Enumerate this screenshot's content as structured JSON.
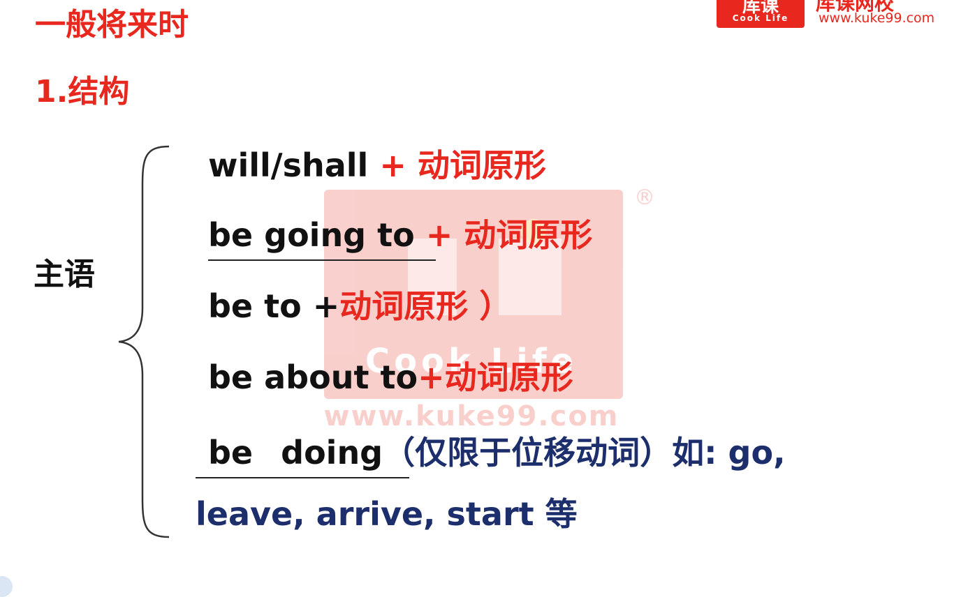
{
  "heading": {
    "title": "一般将来时",
    "section": "1.结构"
  },
  "subject_label": "主语",
  "rows": [
    {
      "black": "will/shall",
      "red": " + 动词原形"
    },
    {
      "black": "be going to",
      "red": " + 动词原形"
    },
    {
      "black": "be to +",
      "red": "动词原形 ）"
    },
    {
      "black": "be about to",
      "red": "+动词原形"
    },
    {
      "black_a": "be",
      "black_b": "doing",
      "blue": "（仅限于位移动词）如:   go,"
    },
    {
      "blue": "leave, arrive, start 等"
    }
  ],
  "logo": {
    "mark": "库课",
    "english": "Cook Life",
    "chinese": "库课网校",
    "url": "www.kuke99.com"
  },
  "watermark": {
    "english": "Cook Life",
    "url": "www.kuke99.com",
    "registered": "®"
  },
  "colors": {
    "accent_red": "#e8281e",
    "text_black": "#111111",
    "text_blue": "#1c2e6b"
  }
}
